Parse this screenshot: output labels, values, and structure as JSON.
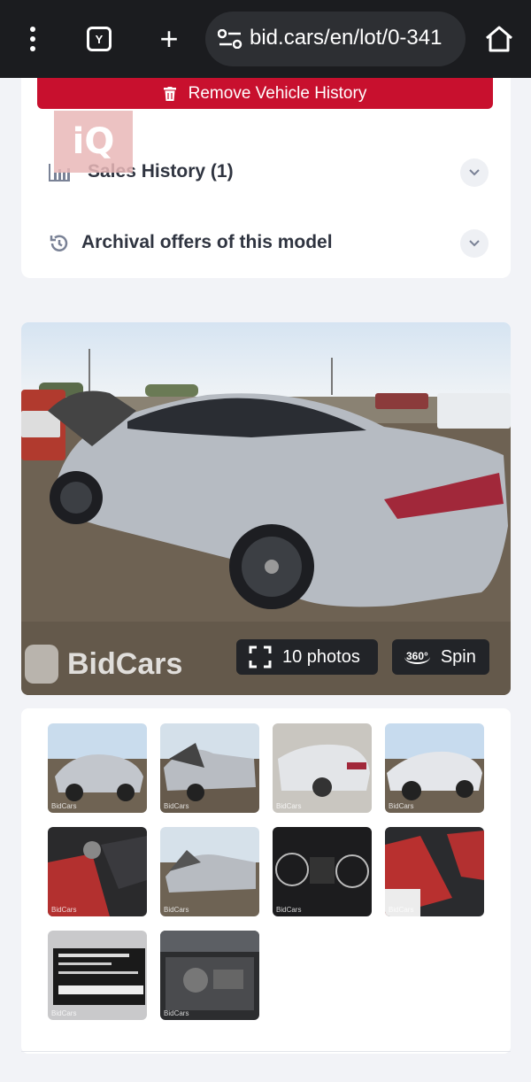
{
  "browser": {
    "tab_count": "Y",
    "new_tab": "+",
    "url": "bid.cars/en/lot/0-341"
  },
  "top_card": {
    "remove_history_label": "Remove Vehicle History",
    "overlay_logo_text": "iQ",
    "sales_history_label": "Sales History (1)",
    "archival_offers_label": "Archival offers of this model"
  },
  "gallery": {
    "watermark": "BidCars",
    "photos_label": "10 photos",
    "spin_label": "Spin",
    "spin_badge": "360°",
    "thumb_watermark": "BidCars",
    "thumbnails": [
      {
        "name": "exterior-front-left"
      },
      {
        "name": "front-damage"
      },
      {
        "name": "exterior-rear-right"
      },
      {
        "name": "exterior-front-left-2"
      },
      {
        "name": "interior-front-seats"
      },
      {
        "name": "front-damage-2"
      },
      {
        "name": "instrument-cluster"
      },
      {
        "name": "interior-rear-seats"
      },
      {
        "name": "door-label-sticker"
      },
      {
        "name": "engine-bay"
      }
    ]
  },
  "colors": {
    "accent_red": "#c8102e",
    "browser_bg": "#1b1c1f",
    "page_bg": "#f2f3f7"
  }
}
